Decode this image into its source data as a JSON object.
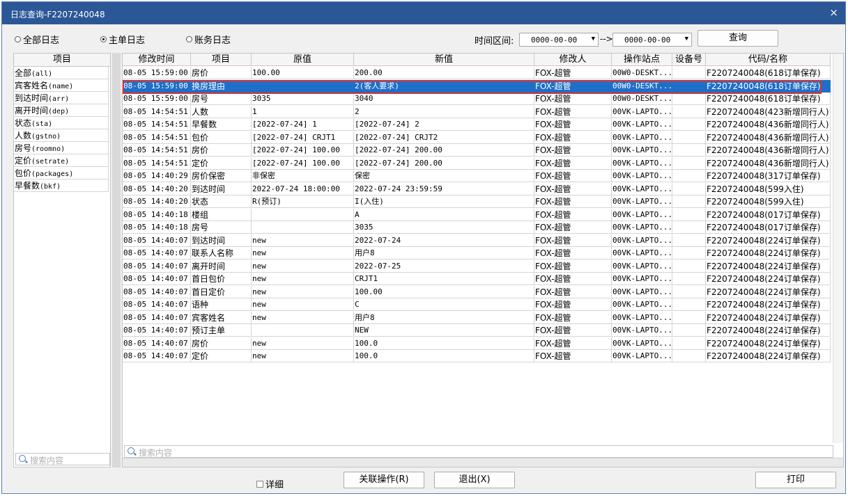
{
  "window": {
    "title": "日志查询-F2207240048",
    "close_icon": "×"
  },
  "filters": {
    "options": [
      {
        "label": "全部日志",
        "selected": false
      },
      {
        "label": "主单日志",
        "selected": true
      },
      {
        "label": "账务日志",
        "selected": false
      }
    ],
    "time_label": "时间区间:",
    "from_date": "0000-00-00",
    "to_date": "0000-00-00",
    "arrow": "-->",
    "query_label": "查询"
  },
  "left_panel": {
    "header": "项目",
    "items": [
      {
        "cn": "全部",
        "en": "(all)"
      },
      {
        "cn": "宾客姓名",
        "en": "(name)"
      },
      {
        "cn": "到达时间",
        "en": "(arr)"
      },
      {
        "cn": "离开时间",
        "en": "(dep)"
      },
      {
        "cn": "状态",
        "en": "(sta)"
      },
      {
        "cn": "人数",
        "en": "(gstno)"
      },
      {
        "cn": "房号",
        "en": "(roomno)"
      },
      {
        "cn": "定价",
        "en": "(setrate)"
      },
      {
        "cn": "包价",
        "en": "(packages)"
      },
      {
        "cn": "早餐数",
        "en": "(bkf)"
      }
    ],
    "search_placeholder": "搜索内容"
  },
  "grid": {
    "columns": [
      "修改时间",
      "项目",
      "原值",
      "新值",
      "修改人",
      "操作站点",
      "设备号",
      "代码/名称"
    ],
    "selected_row": 1,
    "rows": [
      [
        "08-05 15:59:00",
        "房价",
        "100.00",
        "200.00",
        "FOX-超管",
        "00W0-DESKT...",
        "",
        "F2207240048(618订单保存)"
      ],
      [
        "08-05 15:59:00",
        "换房理由",
        "",
        "2(客人要求)",
        "FOX-超管",
        "00W0-DESKT...",
        "",
        "F2207240048(618订单保存)"
      ],
      [
        "08-05 15:59:00",
        "房号",
        "3035",
        "3040",
        "FOX-超管",
        "00W0-DESKT...",
        "",
        "F2207240048(618订单保存)"
      ],
      [
        "08-05 14:54:51",
        "人数",
        "1",
        "2",
        "FOX-超管",
        "00VK-LAPTO...",
        "",
        "F2207240048(423新增同行人)"
      ],
      [
        "08-05 14:54:51",
        "早餐数",
        "[2022-07-24] 1",
        "[2022-07-24] 2",
        "FOX-超管",
        "00VK-LAPTO...",
        "",
        "F2207240048(436新增同行人)"
      ],
      [
        "08-05 14:54:51",
        "包价",
        "[2022-07-24] CRJT1",
        "[2022-07-24] CRJT2",
        "FOX-超管",
        "00VK-LAPTO...",
        "",
        "F2207240048(436新增同行人)"
      ],
      [
        "08-05 14:54:51",
        "房价",
        "[2022-07-24] 100.00",
        "[2022-07-24] 200.00",
        "FOX-超管",
        "00VK-LAPTO...",
        "",
        "F2207240048(436新增同行人)"
      ],
      [
        "08-05 14:54:51",
        "定价",
        "[2022-07-24] 100.00",
        "[2022-07-24] 200.00",
        "FOX-超管",
        "00VK-LAPTO...",
        "",
        "F2207240048(436新增同行人)"
      ],
      [
        "08-05 14:40:29",
        "房价保密",
        "非保密",
        "保密",
        "FOX-超管",
        "00VK-LAPTO...",
        "",
        "F2207240048(317订单保存)"
      ],
      [
        "08-05 14:40:20",
        "到达时间",
        "2022-07-24 18:00:00",
        "2022-07-24 23:59:59",
        "FOX-超管",
        "00VK-LAPTO...",
        "",
        "F2207240048(599入住)"
      ],
      [
        "08-05 14:40:20",
        "状态",
        "R(预订)",
        "I(入住)",
        "FOX-超管",
        "00VK-LAPTO...",
        "",
        "F2207240048(599入住)"
      ],
      [
        "08-05 14:40:18",
        "楼组",
        "",
        "A",
        "FOX-超管",
        "00VK-LAPTO...",
        "",
        "F2207240048(017订单保存)"
      ],
      [
        "08-05 14:40:18",
        "房号",
        "",
        "3035",
        "FOX-超管",
        "00VK-LAPTO...",
        "",
        "F2207240048(017订单保存)"
      ],
      [
        "08-05 14:40:07",
        "到达时间",
        "new",
        "2022-07-24",
        "FOX-超管",
        "00VK-LAPTO...",
        "",
        "F2207240048(224订单保存)"
      ],
      [
        "08-05 14:40:07",
        "联系人名称",
        "new",
        "用户8",
        "FOX-超管",
        "00VK-LAPTO...",
        "",
        "F2207240048(224订单保存)"
      ],
      [
        "08-05 14:40:07",
        "离开时间",
        "new",
        "2022-07-25",
        "FOX-超管",
        "00VK-LAPTO...",
        "",
        "F2207240048(224订单保存)"
      ],
      [
        "08-05 14:40:07",
        "首日包价",
        "new",
        "CRJT1",
        "FOX-超管",
        "00VK-LAPTO...",
        "",
        "F2207240048(224订单保存)"
      ],
      [
        "08-05 14:40:07",
        "首日定价",
        "new",
        "100.00",
        "FOX-超管",
        "00VK-LAPTO...",
        "",
        "F2207240048(224订单保存)"
      ],
      [
        "08-05 14:40:07",
        "语种",
        "new",
        "C",
        "FOX-超管",
        "00VK-LAPTO...",
        "",
        "F2207240048(224订单保存)"
      ],
      [
        "08-05 14:40:07",
        "宾客姓名",
        "new",
        "用户8",
        "FOX-超管",
        "00VK-LAPTO...",
        "",
        "F2207240048(224订单保存)"
      ],
      [
        "08-05 14:40:07",
        "预订主单",
        "",
        "NEW",
        "FOX-超管",
        "00VK-LAPTO...",
        "",
        "F2207240048(224订单保存)"
      ],
      [
        "08-05 14:40:07",
        "房价",
        "new",
        "100.0",
        "FOX-超管",
        "00VK-LAPTO...",
        "",
        "F2207240048(224订单保存)"
      ],
      [
        "08-05 14:40:07",
        "定价",
        "new",
        "100.0",
        "FOX-超管",
        "00VK-LAPTO...",
        "",
        "F2207240048(224订单保存)"
      ]
    ],
    "search_placeholder": "搜索内容"
  },
  "footer": {
    "detail_label": "详细",
    "related_label": "关联操作(R)",
    "exit_label": "退出(X)",
    "print_label": "打印"
  }
}
